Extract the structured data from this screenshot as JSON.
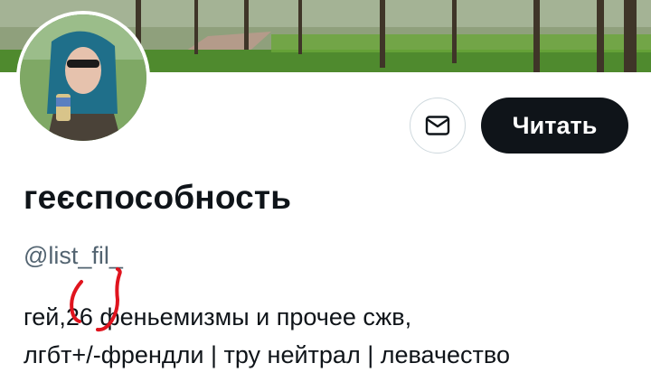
{
  "profile": {
    "display_name": "геєспособность",
    "handle": "@list_fil_",
    "bio": {
      "line1_before": "гей,",
      "age": "26",
      "line1_after": "феньемизмы и прочее сжв,",
      "line2": "лгбт+/-френдли | тру нейтрал | левачество"
    }
  },
  "actions": {
    "follow_label": "Читать"
  },
  "icons": {
    "message": "envelope-icon"
  },
  "colors": {
    "follow_bg": "#0f1419",
    "handle": "#536471",
    "annotation": "#e0141e"
  }
}
